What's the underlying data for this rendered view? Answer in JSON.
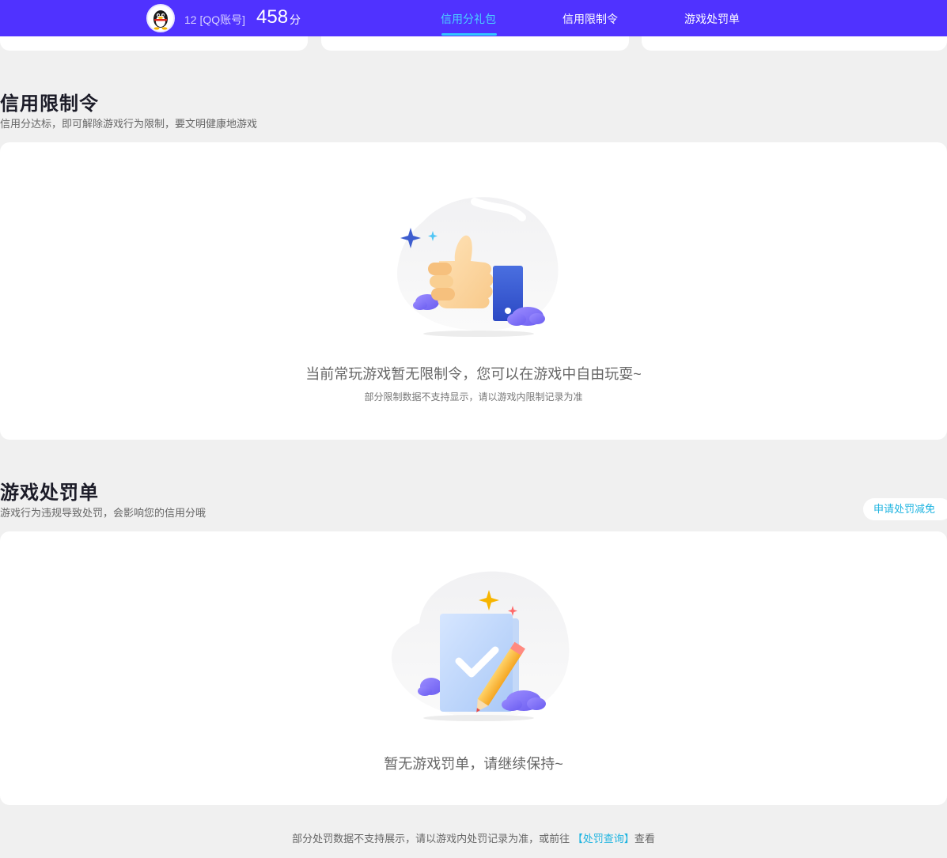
{
  "header": {
    "account_level": "12",
    "account_type": "[QQ账号]",
    "score": "458",
    "score_unit": "分",
    "tabs": [
      {
        "label": "信用分礼包",
        "active": true
      },
      {
        "label": "信用限制令",
        "active": false
      },
      {
        "label": "游戏处罚单",
        "active": false
      }
    ]
  },
  "restriction": {
    "title": "信用限制令",
    "subtitle": "信用分达标，即可解除游戏行为限制，要文明健康地游戏",
    "empty_message": "当前常玩游戏暂无限制令，您可以在游戏中自由玩耍~",
    "empty_note": "部分限制数据不支持显示，请以游戏内限制记录为准"
  },
  "penalty": {
    "title": "游戏处罚单",
    "subtitle": "游戏行为违规导致处罚，会影响您的信用分哦",
    "reduce_button": "申请处罚减免",
    "empty_message": "暂无游戏罚单，请继续保持~"
  },
  "footer": {
    "text_before": "部分处罚数据不支持展示，请以游戏内处罚记录为准，或前往",
    "link": "【处罚查询】",
    "text_after": "查看"
  },
  "colors": {
    "header_bg": "#5032ff",
    "active_tab": "#49d2ff",
    "link": "#1fb4e0",
    "page_bg": "#f0f0f0"
  }
}
